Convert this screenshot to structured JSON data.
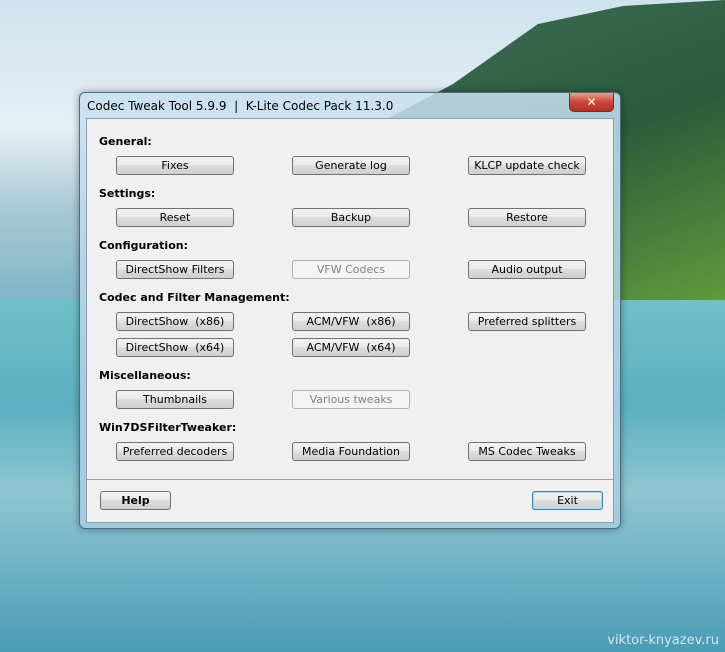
{
  "window": {
    "title": "Codec Tweak Tool 5.9.9  |  K-Lite Codec Pack 11.3.0",
    "close": "✕"
  },
  "sections": {
    "general": {
      "label": "General:",
      "buttons": [
        "Fixes",
        "Generate log",
        "KLCP update check"
      ]
    },
    "settings": {
      "label": "Settings:",
      "buttons": [
        "Reset",
        "Backup",
        "Restore"
      ]
    },
    "configuration": {
      "label": "Configuration:",
      "buttons": [
        "DirectShow Filters",
        "VFW Codecs",
        "Audio output"
      ]
    },
    "codec": {
      "label": "Codec and Filter Management:",
      "buttons": [
        "DirectShow  (x86)",
        "ACM/VFW  (x86)",
        "Preferred splitters",
        "DirectShow  (x64)",
        "ACM/VFW  (x64)"
      ]
    },
    "misc": {
      "label": "Miscellaneous:",
      "buttons": [
        "Thumbnails",
        "Various tweaks"
      ]
    },
    "win7": {
      "label": "Win7DSFilterTweaker:",
      "buttons": [
        "Preferred decoders",
        "Media Foundation",
        "MS Codec Tweaks"
      ]
    }
  },
  "footer": {
    "help": "Help",
    "exit": "Exit"
  },
  "watermark": "viktor-knyazev.ru"
}
